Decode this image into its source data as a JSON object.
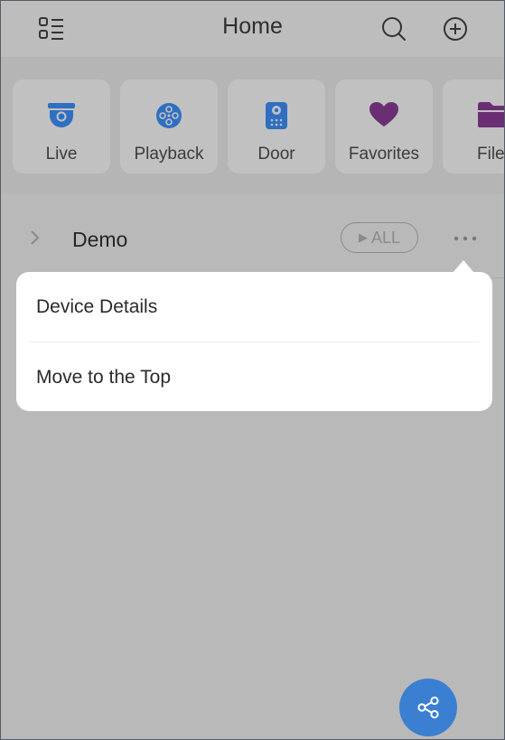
{
  "header": {
    "title": "Home"
  },
  "quick_access": [
    {
      "label": "Live"
    },
    {
      "label": "Playback"
    },
    {
      "label": "Door"
    },
    {
      "label": "Favorites"
    },
    {
      "label": "File"
    }
  ],
  "device_row": {
    "label": "Demo",
    "all_button_label": "ALL"
  },
  "popup_menu": {
    "items": [
      {
        "label": "Device Details"
      },
      {
        "label": "Move to the Top"
      }
    ]
  },
  "colors": {
    "accent_blue": "#2f6fc1",
    "favorites_purple": "#6a2f73",
    "overlay_gray": "#b9b9b9",
    "fab_blue": "#3a7fd2"
  },
  "icons": {
    "menu": "list-menu-icon",
    "search": "search-icon",
    "add": "add-circle-icon",
    "live": "dome-camera-icon",
    "playback": "film-reel-icon",
    "door": "door-intercom-icon",
    "favorites": "heart-icon",
    "file": "folder-icon",
    "expand": "chevron-right-icon",
    "more": "more-dots-icon",
    "share": "share-icon"
  }
}
